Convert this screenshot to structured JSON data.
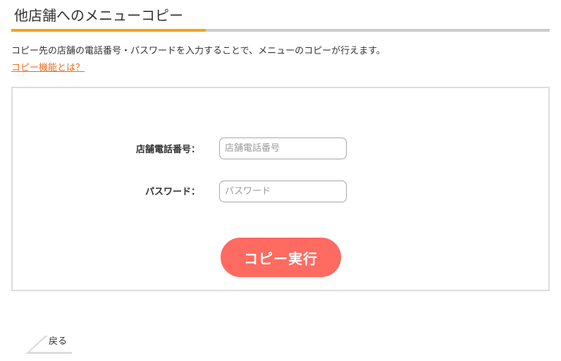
{
  "header": {
    "title": "他店舗へのメニューコピー"
  },
  "intro": {
    "description": "コピー先の店舗の電話番号・パスワードを入力することで、メニューのコピーが行えます。",
    "help_link": "コピー機能とは？"
  },
  "form": {
    "phone_label": "店舗電話番号：",
    "phone_placeholder": "店舗電話番号",
    "phone_value": "",
    "password_label": "パスワード：",
    "password_placeholder": "パスワード",
    "password_value": "",
    "submit_label": "コピー実行"
  },
  "footer": {
    "back_label": "戻る",
    "back_icon": "back-arrow-icon"
  },
  "colors": {
    "accent": "#f7a21b",
    "rule": "#cccccc",
    "link": "#ef6a1e",
    "button": "#ff6a61",
    "panel_border": "#dddddd"
  }
}
